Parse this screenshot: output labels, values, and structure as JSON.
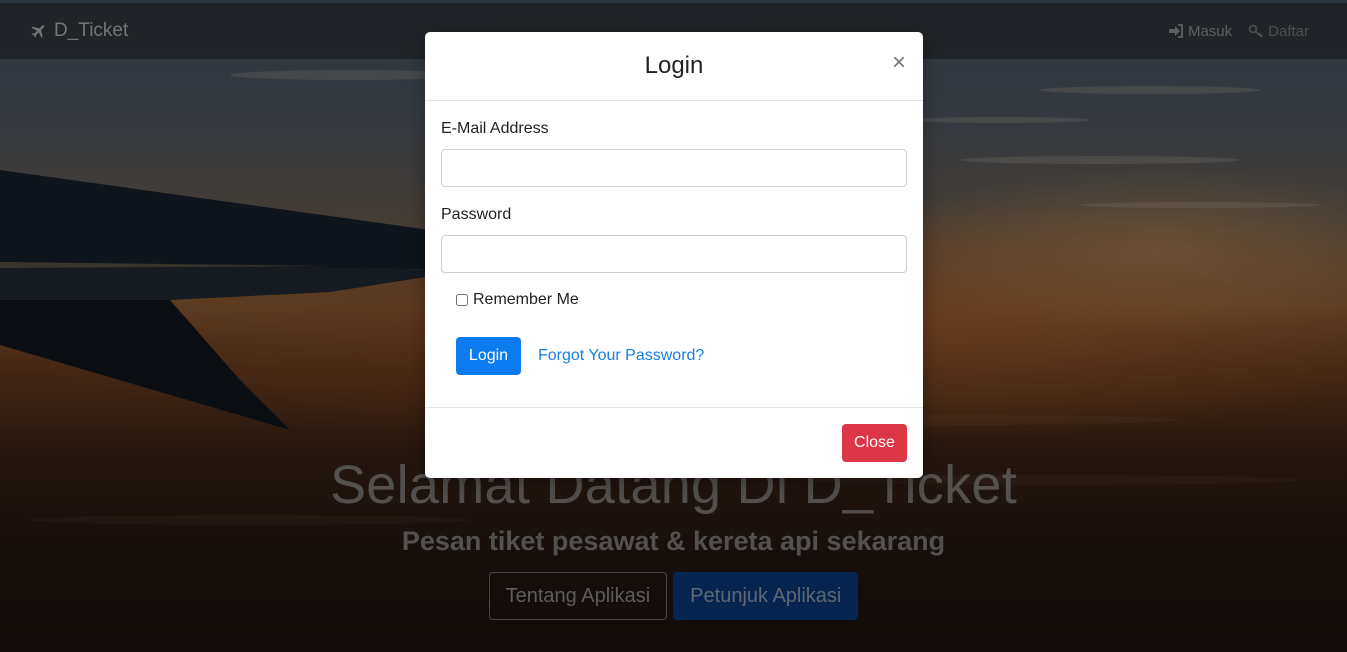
{
  "navbar": {
    "brand": "D_Ticket",
    "brand_icon": "plane-icon",
    "links": [
      {
        "label": "Masuk",
        "icon": "sign-in-icon"
      },
      {
        "label": "Daftar",
        "icon": "key-icon"
      }
    ]
  },
  "hero": {
    "title": "Selamat Datang Di D_Ticket",
    "subtitle": "Pesan tiket pesawat & kereta api sekarang",
    "buttons": [
      {
        "label": "Tentang Aplikasi"
      },
      {
        "label": "Petunjuk Aplikasi"
      }
    ]
  },
  "modal": {
    "title": "Login",
    "close_x": "×",
    "email_label": "E-Mail Address",
    "email_value": "",
    "password_label": "Password",
    "password_value": "",
    "remember_label": "Remember Me",
    "remember_checked": false,
    "login_label": "Login",
    "forgot_label": "Forgot Your Password?",
    "close_label": "Close"
  },
  "colors": {
    "primary": "#0d7bf0",
    "danger": "#dc3545",
    "link": "#1a7fe0",
    "hero_primary": "#0a4aa0"
  }
}
